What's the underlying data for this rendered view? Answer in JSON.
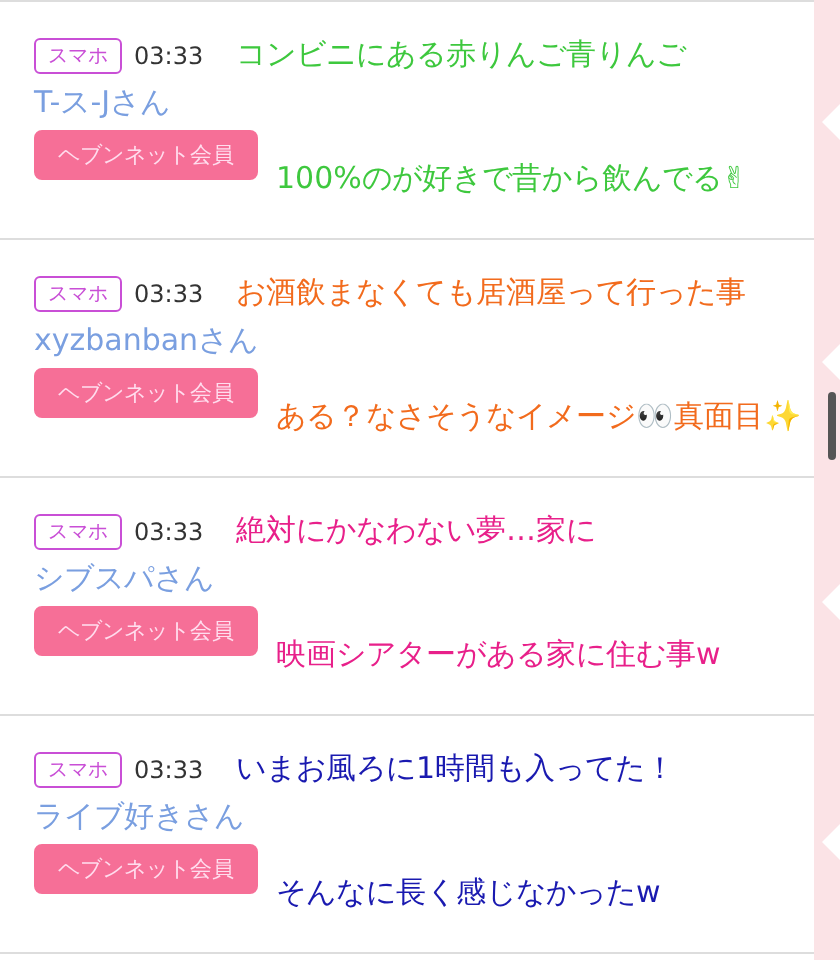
{
  "posts": [
    {
      "device": "スマホ",
      "time": "03:33",
      "name": "T-ス-Jさん",
      "member_button": "ヘブンネット会員",
      "caption": {
        "color": "#3ec83e",
        "lines": [
          "コンビニにある赤りんご青りんご",
          "100%のが好きで昔から飲んでる✌"
        ]
      }
    },
    {
      "device": "スマホ",
      "time": "03:33",
      "name": "xyzbanbanさん",
      "member_button": "ヘブンネット会員",
      "caption": {
        "color": "#f26b1d",
        "lines": [
          "お酒飲まなくても居酒屋って行った事",
          "ある？なさそうなイメージ👀真面目✨"
        ]
      }
    },
    {
      "device": "スマホ",
      "time": "03:33",
      "name": "シブスパさん",
      "member_button": "ヘブンネット会員",
      "caption": {
        "color": "#e8208a",
        "lines": [
          "絶対にかなわない夢…家に",
          "映画シアターがある家に住む事w"
        ]
      }
    },
    {
      "device": "スマホ",
      "time": "03:33",
      "name": "ライブ好きさん",
      "member_button": "ヘブンネット会員",
      "caption": {
        "color": "#1a1ab0",
        "lines": [
          "いまお風ろに1時間も入ってた！",
          "そんなに長く感じなかったw"
        ]
      }
    }
  ]
}
